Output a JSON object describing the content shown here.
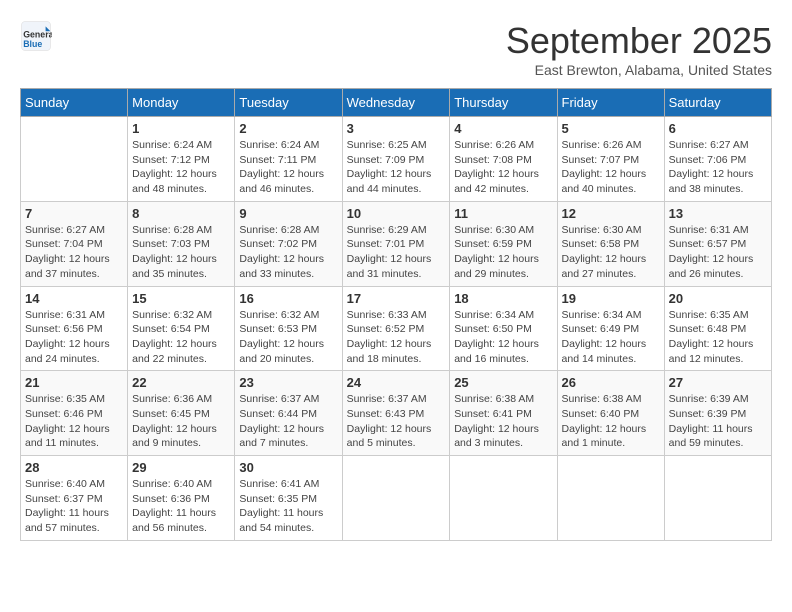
{
  "header": {
    "logo_general": "General",
    "logo_blue": "Blue",
    "title": "September 2025",
    "location": "East Brewton, Alabama, United States"
  },
  "days_of_week": [
    "Sunday",
    "Monday",
    "Tuesday",
    "Wednesday",
    "Thursday",
    "Friday",
    "Saturday"
  ],
  "weeks": [
    [
      {
        "day": "",
        "sunrise": "",
        "sunset": "",
        "daylight": ""
      },
      {
        "day": "1",
        "sunrise": "Sunrise: 6:24 AM",
        "sunset": "Sunset: 7:12 PM",
        "daylight": "Daylight: 12 hours and 48 minutes."
      },
      {
        "day": "2",
        "sunrise": "Sunrise: 6:24 AM",
        "sunset": "Sunset: 7:11 PM",
        "daylight": "Daylight: 12 hours and 46 minutes."
      },
      {
        "day": "3",
        "sunrise": "Sunrise: 6:25 AM",
        "sunset": "Sunset: 7:09 PM",
        "daylight": "Daylight: 12 hours and 44 minutes."
      },
      {
        "day": "4",
        "sunrise": "Sunrise: 6:26 AM",
        "sunset": "Sunset: 7:08 PM",
        "daylight": "Daylight: 12 hours and 42 minutes."
      },
      {
        "day": "5",
        "sunrise": "Sunrise: 6:26 AM",
        "sunset": "Sunset: 7:07 PM",
        "daylight": "Daylight: 12 hours and 40 minutes."
      },
      {
        "day": "6",
        "sunrise": "Sunrise: 6:27 AM",
        "sunset": "Sunset: 7:06 PM",
        "daylight": "Daylight: 12 hours and 38 minutes."
      }
    ],
    [
      {
        "day": "7",
        "sunrise": "Sunrise: 6:27 AM",
        "sunset": "Sunset: 7:04 PM",
        "daylight": "Daylight: 12 hours and 37 minutes."
      },
      {
        "day": "8",
        "sunrise": "Sunrise: 6:28 AM",
        "sunset": "Sunset: 7:03 PM",
        "daylight": "Daylight: 12 hours and 35 minutes."
      },
      {
        "day": "9",
        "sunrise": "Sunrise: 6:28 AM",
        "sunset": "Sunset: 7:02 PM",
        "daylight": "Daylight: 12 hours and 33 minutes."
      },
      {
        "day": "10",
        "sunrise": "Sunrise: 6:29 AM",
        "sunset": "Sunset: 7:01 PM",
        "daylight": "Daylight: 12 hours and 31 minutes."
      },
      {
        "day": "11",
        "sunrise": "Sunrise: 6:30 AM",
        "sunset": "Sunset: 6:59 PM",
        "daylight": "Daylight: 12 hours and 29 minutes."
      },
      {
        "day": "12",
        "sunrise": "Sunrise: 6:30 AM",
        "sunset": "Sunset: 6:58 PM",
        "daylight": "Daylight: 12 hours and 27 minutes."
      },
      {
        "day": "13",
        "sunrise": "Sunrise: 6:31 AM",
        "sunset": "Sunset: 6:57 PM",
        "daylight": "Daylight: 12 hours and 26 minutes."
      }
    ],
    [
      {
        "day": "14",
        "sunrise": "Sunrise: 6:31 AM",
        "sunset": "Sunset: 6:56 PM",
        "daylight": "Daylight: 12 hours and 24 minutes."
      },
      {
        "day": "15",
        "sunrise": "Sunrise: 6:32 AM",
        "sunset": "Sunset: 6:54 PM",
        "daylight": "Daylight: 12 hours and 22 minutes."
      },
      {
        "day": "16",
        "sunrise": "Sunrise: 6:32 AM",
        "sunset": "Sunset: 6:53 PM",
        "daylight": "Daylight: 12 hours and 20 minutes."
      },
      {
        "day": "17",
        "sunrise": "Sunrise: 6:33 AM",
        "sunset": "Sunset: 6:52 PM",
        "daylight": "Daylight: 12 hours and 18 minutes."
      },
      {
        "day": "18",
        "sunrise": "Sunrise: 6:34 AM",
        "sunset": "Sunset: 6:50 PM",
        "daylight": "Daylight: 12 hours and 16 minutes."
      },
      {
        "day": "19",
        "sunrise": "Sunrise: 6:34 AM",
        "sunset": "Sunset: 6:49 PM",
        "daylight": "Daylight: 12 hours and 14 minutes."
      },
      {
        "day": "20",
        "sunrise": "Sunrise: 6:35 AM",
        "sunset": "Sunset: 6:48 PM",
        "daylight": "Daylight: 12 hours and 12 minutes."
      }
    ],
    [
      {
        "day": "21",
        "sunrise": "Sunrise: 6:35 AM",
        "sunset": "Sunset: 6:46 PM",
        "daylight": "Daylight: 12 hours and 11 minutes."
      },
      {
        "day": "22",
        "sunrise": "Sunrise: 6:36 AM",
        "sunset": "Sunset: 6:45 PM",
        "daylight": "Daylight: 12 hours and 9 minutes."
      },
      {
        "day": "23",
        "sunrise": "Sunrise: 6:37 AM",
        "sunset": "Sunset: 6:44 PM",
        "daylight": "Daylight: 12 hours and 7 minutes."
      },
      {
        "day": "24",
        "sunrise": "Sunrise: 6:37 AM",
        "sunset": "Sunset: 6:43 PM",
        "daylight": "Daylight: 12 hours and 5 minutes."
      },
      {
        "day": "25",
        "sunrise": "Sunrise: 6:38 AM",
        "sunset": "Sunset: 6:41 PM",
        "daylight": "Daylight: 12 hours and 3 minutes."
      },
      {
        "day": "26",
        "sunrise": "Sunrise: 6:38 AM",
        "sunset": "Sunset: 6:40 PM",
        "daylight": "Daylight: 12 hours and 1 minute."
      },
      {
        "day": "27",
        "sunrise": "Sunrise: 6:39 AM",
        "sunset": "Sunset: 6:39 PM",
        "daylight": "Daylight: 11 hours and 59 minutes."
      }
    ],
    [
      {
        "day": "28",
        "sunrise": "Sunrise: 6:40 AM",
        "sunset": "Sunset: 6:37 PM",
        "daylight": "Daylight: 11 hours and 57 minutes."
      },
      {
        "day": "29",
        "sunrise": "Sunrise: 6:40 AM",
        "sunset": "Sunset: 6:36 PM",
        "daylight": "Daylight: 11 hours and 56 minutes."
      },
      {
        "day": "30",
        "sunrise": "Sunrise: 6:41 AM",
        "sunset": "Sunset: 6:35 PM",
        "daylight": "Daylight: 11 hours and 54 minutes."
      },
      {
        "day": "",
        "sunrise": "",
        "sunset": "",
        "daylight": ""
      },
      {
        "day": "",
        "sunrise": "",
        "sunset": "",
        "daylight": ""
      },
      {
        "day": "",
        "sunrise": "",
        "sunset": "",
        "daylight": ""
      },
      {
        "day": "",
        "sunrise": "",
        "sunset": "",
        "daylight": ""
      }
    ]
  ]
}
